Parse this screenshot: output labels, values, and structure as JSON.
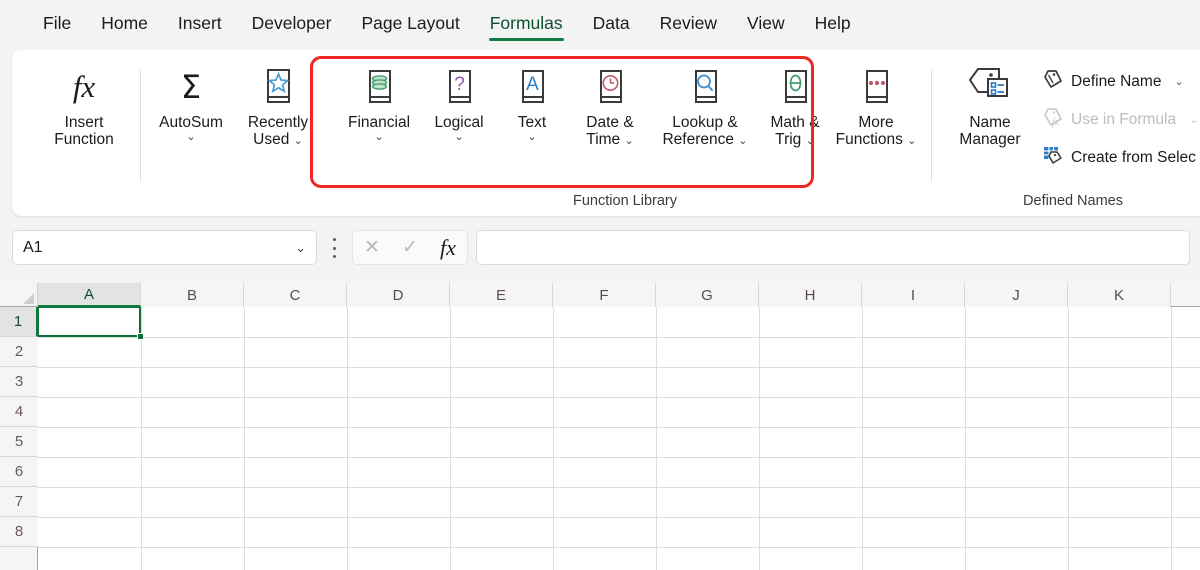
{
  "tabs": [
    {
      "label": "File",
      "active": false
    },
    {
      "label": "Home",
      "active": false
    },
    {
      "label": "Insert",
      "active": false
    },
    {
      "label": "Developer",
      "active": false
    },
    {
      "label": "Page Layout",
      "active": false
    },
    {
      "label": "Formulas",
      "active": true
    },
    {
      "label": "Data",
      "active": false
    },
    {
      "label": "Review",
      "active": false
    },
    {
      "label": "View",
      "active": false
    },
    {
      "label": "Help",
      "active": false
    }
  ],
  "ribbon": {
    "groups": [
      {
        "caption": ""
      },
      {
        "caption": "Function Library"
      },
      {
        "caption": "Defined Names"
      }
    ],
    "insert_function": {
      "line1": "Insert",
      "line2": "Function",
      "icon": "fx-icon"
    },
    "autosum": {
      "line1": "AutoSum",
      "chevron": "⌄",
      "icon": "sigma-icon"
    },
    "recently_used": {
      "line1": "Recently",
      "line2": "Used",
      "chevron": "⌄",
      "icon": "star-book-icon"
    },
    "function_library": {
      "caption": "Function Library",
      "buttons": [
        {
          "line1": "Financial",
          "line2": "",
          "chevron": "⌄",
          "icon": "coins-book-icon",
          "accent": "#4a9c6d"
        },
        {
          "line1": "Logical",
          "line2": "",
          "chevron": "⌄",
          "icon": "question-book-icon",
          "accent": "#9a4fb0"
        },
        {
          "line1": "Text",
          "line2": "",
          "chevron": "⌄",
          "icon": "letter-a-book-icon",
          "accent": "#2b7cc4"
        },
        {
          "line1": "Date &",
          "line2": "Time",
          "chevron": "⌄",
          "icon": "clock-book-icon",
          "accent": "#c2576b"
        },
        {
          "line1": "Lookup &",
          "line2": "Reference",
          "chevron": "⌄",
          "icon": "magnifier-book-icon",
          "accent": "#3f8ed0"
        },
        {
          "line1": "Math &",
          "line2": "Trig",
          "chevron": "⌄",
          "icon": "theta-book-icon",
          "accent": "#3f9a6a"
        }
      ]
    },
    "more_functions": {
      "line1": "More",
      "line2": "Functions",
      "chevron": "⌄",
      "icon": "ellipsis-book-icon"
    },
    "defined_names": {
      "caption": "Defined Names",
      "name_manager": {
        "line1": "Name",
        "line2": "Manager",
        "icon": "name-tag-icon"
      },
      "rows": [
        {
          "label": "Define Name",
          "icon": "tag-icon",
          "chevron": "⌄",
          "disabled": false
        },
        {
          "label": "Use in Formula",
          "icon": "tag-fx-icon",
          "chevron": "⌄",
          "disabled": true
        },
        {
          "label": "Create from Selec",
          "icon": "table-tag-icon",
          "chevron": "",
          "disabled": false
        }
      ]
    },
    "highlight_color": "#ee2722"
  },
  "formula_bar": {
    "name_box_value": "A1",
    "name_box_chevron": "⌄",
    "kebab_icon": "more-options-icon",
    "cancel_icon": "✕",
    "confirm_icon": "✓",
    "fx_icon": "fx",
    "formula_value": "",
    "formula_placeholder": ""
  },
  "sheet": {
    "select_all_icon": "select-all-corner",
    "columns": [
      "A",
      "B",
      "C",
      "D",
      "E",
      "F",
      "G",
      "H",
      "I",
      "J",
      "K"
    ],
    "selected_column": "A",
    "rows": [
      "1",
      "2",
      "3",
      "4",
      "5",
      "6",
      "7",
      "8"
    ],
    "selected_row": "1",
    "active_cell": "A1",
    "active_cell_color": "#10703a"
  }
}
